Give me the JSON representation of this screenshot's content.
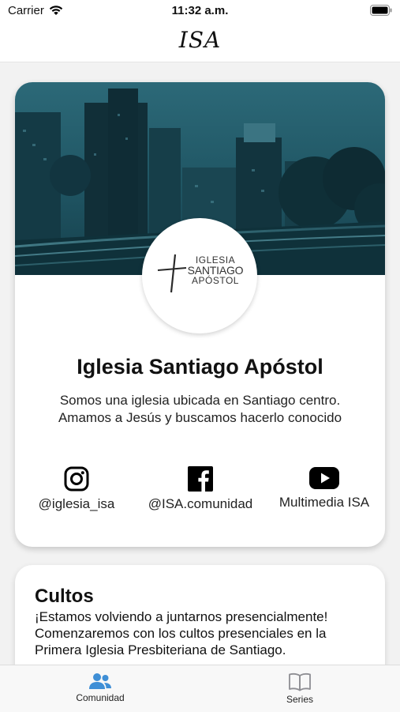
{
  "status_bar": {
    "carrier": "Carrier",
    "time": "11:32 a.m.",
    "wifi_icon": "wifi-icon",
    "battery_icon": "battery-icon"
  },
  "nav": {
    "title": "ISA"
  },
  "church": {
    "logo": {
      "line1": "IGLESIA",
      "line2": "SANTIAGO",
      "line3": "APÓSTOL"
    },
    "name": "Iglesia Santiago Apóstol",
    "description": "Somos una iglesia ubicada en Santiago centro. Amamos a Jesús y buscamos hacerlo conocido"
  },
  "social": [
    {
      "icon": "instagram-icon",
      "label": "@iglesia_isa"
    },
    {
      "icon": "facebook-icon",
      "label": "@ISA.comunidad"
    },
    {
      "icon": "youtube-icon",
      "label": "Multimedia ISA"
    }
  ],
  "cultos": {
    "title": "Cultos",
    "body": "¡Estamos volviendo a juntarnos presencialmente! Comenzaremos con los cultos presenciales en la Primera Iglesia Presbiteriana de Santiago."
  },
  "tabs": [
    {
      "icon": "people-icon",
      "label": "Comunidad",
      "selected": true
    },
    {
      "icon": "book-icon",
      "label": "Series",
      "selected": false
    }
  ],
  "colors": {
    "accent": "#3f8fd6",
    "banner_tint": "#1f5563",
    "background": "#f2f2f2"
  }
}
